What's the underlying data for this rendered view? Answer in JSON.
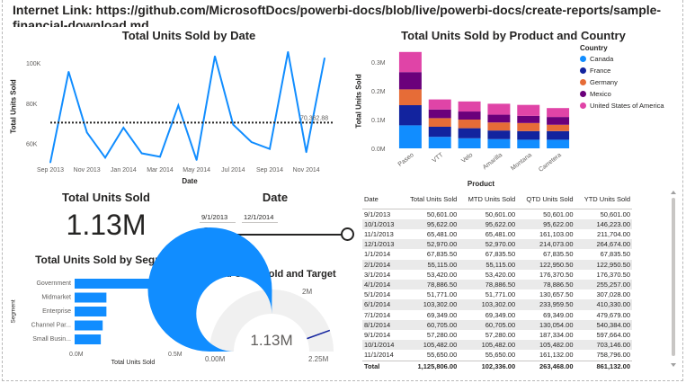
{
  "header": {
    "link_text": "Internet Link: https://github.com/MicrosoftDocs/powerbi-docs/blob/live/powerbi-docs/create-reports/sample-financial-download.md"
  },
  "line_chart": {
    "title": "Total Units Sold by Date",
    "ylabel": "Total Units Sold",
    "xlabel": "Date",
    "x_ticks": [
      "Sep 2013",
      "Nov 2013",
      "Jan 2014",
      "Mar 2014",
      "May 2014",
      "Jul 2014",
      "Sep 2014",
      "Nov 2014"
    ],
    "y_ticks": [
      "100K",
      "80K",
      "60K"
    ],
    "target_label": "70,362.88",
    "line_color": "#118DFF",
    "target_color": "#252423"
  },
  "stacked_chart": {
    "title": "Total Units Sold by Product and Country",
    "ylabel": "Total Units Sold",
    "xlabel": "Product",
    "y_ticks": [
      "0.3M",
      "0.2M",
      "0.1M",
      "0.0M"
    ],
    "legend_title": "Country",
    "legend": [
      {
        "name": "Canada",
        "color": "#118DFF"
      },
      {
        "name": "France",
        "color": "#12239E"
      },
      {
        "name": "Germany",
        "color": "#E66C37"
      },
      {
        "name": "Mexico",
        "color": "#6B007B"
      },
      {
        "name": "United States of America",
        "color": "#E044A7"
      }
    ]
  },
  "card": {
    "title": "Total Units Sold",
    "value": "1.13M"
  },
  "slicer": {
    "title": "Date",
    "start": "9/1/2013",
    "end": "12/1/2014"
  },
  "segment_chart": {
    "title": "Total Units Sold by Segment",
    "ylabel": "Segment",
    "xlabel": "Total Units Sold",
    "x_ticks": [
      "0.0M",
      "0.5M"
    ],
    "bar_color": "#118DFF"
  },
  "gauge": {
    "title": "Total Units Sold and Target",
    "value_label": "1.13M",
    "min_label": "0.00M",
    "max_label": "2.25M",
    "target_label": "2M",
    "value": 1.13,
    "min": 0,
    "max": 2.25,
    "target": 2,
    "fill_color": "#118DFF",
    "track_color": "#f0f0f0"
  },
  "matrix": {
    "headers": [
      "Date",
      "Total Units Sold",
      "MTD Units Sold",
      "QTD Units Sold",
      "YTD Units Sold"
    ],
    "rows": [
      [
        "9/1/2013",
        "50,601.00",
        "50,601.00",
        "50,601.00",
        "50,601.00"
      ],
      [
        "10/1/2013",
        "95,622.00",
        "95,622.00",
        "95,622.00",
        "146,223.00"
      ],
      [
        "11/1/2013",
        "65,481.00",
        "65,481.00",
        "161,103.00",
        "211,704.00"
      ],
      [
        "12/1/2013",
        "52,970.00",
        "52,970.00",
        "214,073.00",
        "264,674.00"
      ],
      [
        "1/1/2014",
        "67,835.50",
        "67,835.50",
        "67,835.50",
        "67,835.50"
      ],
      [
        "2/1/2014",
        "55,115.00",
        "55,115.00",
        "122,950.50",
        "122,950.50"
      ],
      [
        "3/1/2014",
        "53,420.00",
        "53,420.00",
        "176,370.50",
        "176,370.50"
      ],
      [
        "4/1/2014",
        "78,886.50",
        "78,886.50",
        "78,886.50",
        "255,257.00"
      ],
      [
        "5/1/2014",
        "51,771.00",
        "51,771.00",
        "130,657.50",
        "307,028.00"
      ],
      [
        "6/1/2014",
        "103,302.00",
        "103,302.00",
        "233,959.50",
        "410,330.00"
      ],
      [
        "7/1/2014",
        "69,349.00",
        "69,349.00",
        "69,349.00",
        "479,679.00"
      ],
      [
        "8/1/2014",
        "60,705.00",
        "60,705.00",
        "130,054.00",
        "540,384.00"
      ],
      [
        "9/1/2014",
        "57,280.00",
        "57,280.00",
        "187,334.00",
        "597,664.00"
      ],
      [
        "10/1/2014",
        "105,482.00",
        "105,482.00",
        "105,482.00",
        "703,146.00"
      ],
      [
        "11/1/2014",
        "55,650.00",
        "55,650.00",
        "161,132.00",
        "758,796.00"
      ]
    ],
    "total": [
      "Total",
      "1,125,806.00",
      "102,336.00",
      "263,468.00",
      "861,132.00"
    ]
  },
  "chart_data": [
    {
      "type": "line",
      "title": "Total Units Sold by Date",
      "xlabel": "Date",
      "ylabel": "Total Units Sold",
      "x": [
        "2013-09",
        "2013-10",
        "2013-11",
        "2013-12",
        "2014-01",
        "2014-02",
        "2014-03",
        "2014-04",
        "2014-05",
        "2014-06",
        "2014-07",
        "2014-08",
        "2014-09",
        "2014-10",
        "2014-11",
        "2014-12"
      ],
      "series": [
        {
          "name": "Total Units Sold",
          "values": [
            50601,
            95622,
            65481,
            52970,
            67835.5,
            55115,
            53420,
            78886.5,
            51771,
            103302,
            69349,
            60705,
            57280,
            105482,
            55650,
            102336
          ]
        }
      ],
      "reference_line": 70362.88,
      "ylim": [
        50000,
        108000
      ]
    },
    {
      "type": "bar",
      "stacked": true,
      "title": "Total Units Sold by Product and Country",
      "xlabel": "Product",
      "ylabel": "Total Units Sold",
      "categories": [
        "Paseo",
        "VTT",
        "Velo",
        "Amarilla",
        "Montana",
        "Carretera"
      ],
      "series": [
        {
          "name": "Canada",
          "values": [
            80000,
            40000,
            35000,
            32000,
            30000,
            30000
          ]
        },
        {
          "name": "France",
          "values": [
            70000,
            35000,
            35000,
            30000,
            30000,
            30000
          ]
        },
        {
          "name": "Germany",
          "values": [
            55000,
            30000,
            30000,
            28000,
            28000,
            22000
          ]
        },
        {
          "name": "Mexico",
          "values": [
            60000,
            30000,
            28000,
            27000,
            25000,
            27000
          ]
        },
        {
          "name": "United States of America",
          "values": [
            70000,
            35000,
            35000,
            38000,
            38000,
            31000
          ]
        }
      ],
      "ylim": [
        0,
        0.35
      ],
      "y_unit": "M"
    },
    {
      "type": "bar",
      "orientation": "horizontal",
      "title": "Total Units Sold by Segment",
      "xlabel": "Total Units Sold",
      "ylabel": "Segment",
      "categories": [
        "Government",
        "Midmarket",
        "Enterprise",
        "Channel Par...",
        "Small Busin..."
      ],
      "values": [
        0.5,
        0.17,
        0.17,
        0.15,
        0.14
      ],
      "xlim": [
        0,
        0.5
      ],
      "x_unit": "M"
    }
  ]
}
